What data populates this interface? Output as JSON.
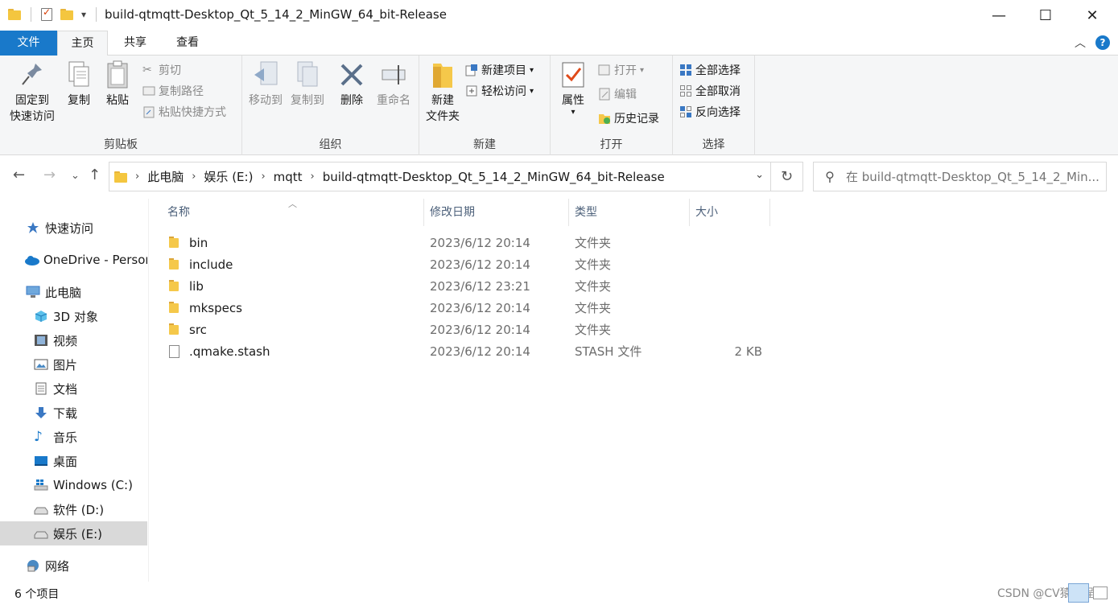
{
  "window": {
    "title": "build-qtmqtt-Desktop_Qt_5_14_2_MinGW_64_bit-Release",
    "qat_dropdown": "▾",
    "minimize": "—",
    "maximize": "☐",
    "close": "✕"
  },
  "tabs": {
    "file": "文件",
    "home": "主页",
    "share": "共享",
    "view": "查看",
    "collapse": "︿",
    "help": "?"
  },
  "ribbon": {
    "clipboard": {
      "label": "剪贴板",
      "pin_line1": "固定到",
      "pin_line2": "快速访问",
      "copy": "复制",
      "paste": "粘贴",
      "cut": "剪切",
      "copy_path": "复制路径",
      "paste_shortcut": "粘贴快捷方式"
    },
    "organize": {
      "label": "组织",
      "move_to": "移动到",
      "copy_to": "复制到",
      "delete": "删除",
      "rename": "重命名"
    },
    "new": {
      "label": "新建",
      "new_folder_line1": "新建",
      "new_folder_line2": "文件夹",
      "new_item": "新建项目",
      "easy_access": "轻松访问"
    },
    "open": {
      "label": "打开",
      "properties": "属性",
      "open": "打开",
      "edit": "编辑",
      "history": "历史记录"
    },
    "select": {
      "label": "选择",
      "select_all": "全部选择",
      "select_none": "全部取消",
      "invert": "反向选择"
    }
  },
  "address": {
    "crumbs": [
      "此电脑",
      "娱乐 (E:)",
      "mqtt",
      "build-qtmqtt-Desktop_Qt_5_14_2_MinGW_64_bit-Release"
    ],
    "search_placeholder": "在 build-qtmqtt-Desktop_Qt_5_14_2_Min..."
  },
  "nav": [
    {
      "label": "快速访问",
      "icon": "star-icon"
    },
    {
      "label": "OneDrive - Persor",
      "icon": "cloud-icon"
    },
    {
      "label": "此电脑",
      "icon": "computer-icon"
    },
    {
      "label": "3D 对象",
      "icon": "cube-icon"
    },
    {
      "label": "视频",
      "icon": "video-icon"
    },
    {
      "label": "图片",
      "icon": "picture-icon"
    },
    {
      "label": "文档",
      "icon": "document-icon"
    },
    {
      "label": "下载",
      "icon": "download-icon"
    },
    {
      "label": "音乐",
      "icon": "music-icon"
    },
    {
      "label": "桌面",
      "icon": "desktop-icon"
    },
    {
      "label": "Windows (C:)",
      "icon": "windows-drive-icon"
    },
    {
      "label": "软件 (D:)",
      "icon": "drive-icon"
    },
    {
      "label": "娱乐 (E:)",
      "icon": "drive-icon",
      "selected": true
    },
    {
      "label": "网络",
      "icon": "network-icon"
    }
  ],
  "columns": {
    "name": "名称",
    "modified": "修改日期",
    "type": "类型",
    "size": "大小"
  },
  "files": [
    {
      "name": "bin",
      "modified": "2023/6/12 20:14",
      "type": "文件夹",
      "size": "",
      "icon": "folder-icon"
    },
    {
      "name": "include",
      "modified": "2023/6/12 20:14",
      "type": "文件夹",
      "size": "",
      "icon": "folder-icon"
    },
    {
      "name": "lib",
      "modified": "2023/6/12 23:21",
      "type": "文件夹",
      "size": "",
      "icon": "folder-icon"
    },
    {
      "name": "mkspecs",
      "modified": "2023/6/12 20:14",
      "type": "文件夹",
      "size": "",
      "icon": "folder-icon"
    },
    {
      "name": "src",
      "modified": "2023/6/12 20:14",
      "type": "文件夹",
      "size": "",
      "icon": "folder-icon"
    },
    {
      "name": ".qmake.stash",
      "modified": "2023/6/12 20:14",
      "type": "STASH 文件",
      "size": "2 KB",
      "icon": "file-icon"
    }
  ],
  "status": {
    "item_count": "6 个项目",
    "watermark": "CSDN @CV猿编程"
  },
  "colors": {
    "accent": "#1979ca",
    "selected_nav": "#d9d9d9",
    "folder": "#f5c84a"
  }
}
